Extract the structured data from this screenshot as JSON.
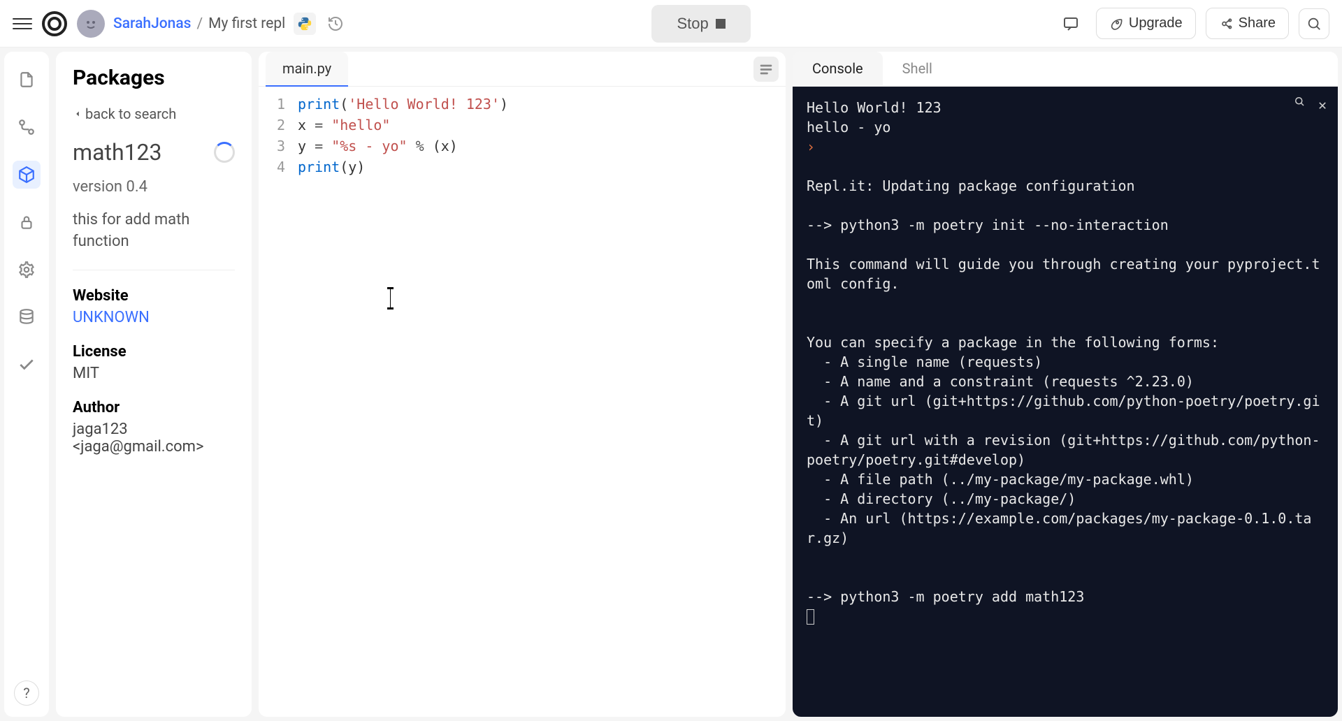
{
  "header": {
    "user": "SarahJonas",
    "separator": "/",
    "repl_name": "My first repl",
    "stop_label": "Stop",
    "upgrade_label": "Upgrade",
    "share_label": "Share"
  },
  "sidebar": {
    "title": "Packages",
    "back_label": "back to search",
    "package_name": "math123",
    "version": "version 0.4",
    "description": "this for add math function",
    "website_label": "Website",
    "website_value": "UNKNOWN",
    "license_label": "License",
    "license_value": "MIT",
    "author_label": "Author",
    "author_value": "jaga123 <jaga@gmail.com>"
  },
  "editor": {
    "tab": "main.py",
    "lines": [
      "1",
      "2",
      "3",
      "4"
    ]
  },
  "console": {
    "tabs": {
      "console": "Console",
      "shell": "Shell"
    },
    "output_line1": "Hello World! 123",
    "output_line2": "hello - yo",
    "msg_updating": "Repl.it: Updating package configuration",
    "msg_poetry_init": "--> python3 -m poetry init --no-interaction",
    "msg_guide": "This command will guide you through creating your pyproject.toml config.",
    "msg_forms_header": "You can specify a package in the following forms:",
    "forms": [
      "  - A single name (requests)",
      "  - A name and a constraint (requests ^2.23.0)",
      "  - A git url (git+https://github.com/python-poetry/poetry.git)",
      "  - A git url with a revision (git+https://github.com/python-poetry/poetry.git#develop)",
      "  - A file path (../my-package/my-package.whl)",
      "  - A directory (../my-package/)",
      "  - An url (https://example.com/packages/my-package-0.1.0.tar.gz)"
    ],
    "msg_poetry_add": "--> python3 -m poetry add math123"
  }
}
